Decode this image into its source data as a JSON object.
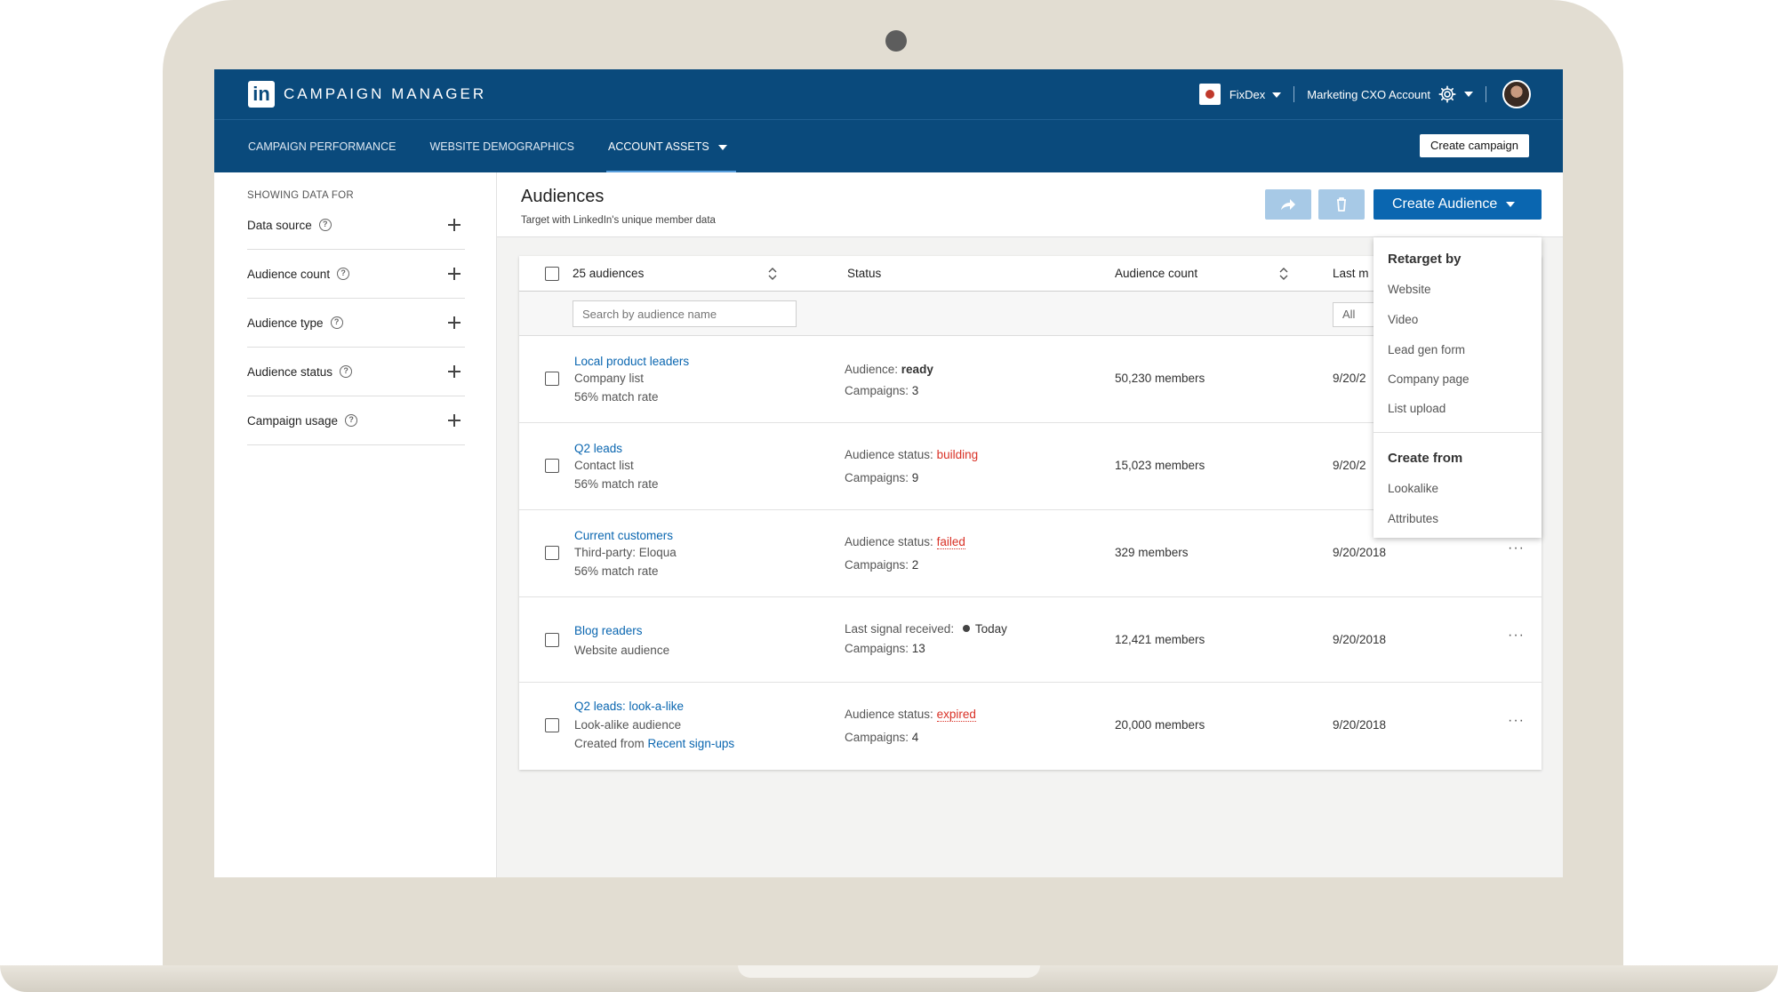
{
  "app": {
    "brand_logo": "in",
    "brand_name": "CAMPAIGN MANAGER",
    "account_name": "FixDex",
    "account_type": "Marketing CXO Account"
  },
  "nav": {
    "tabs": [
      {
        "label": "CAMPAIGN PERFORMANCE"
      },
      {
        "label": "WEBSITE DEMOGRAPHICS"
      },
      {
        "label": "ACCOUNT ASSETS"
      }
    ],
    "create_campaign_label": "Create campaign"
  },
  "sidebar": {
    "heading": "SHOWING DATA FOR",
    "help_glyph": "?",
    "filters": [
      {
        "label": "Data source"
      },
      {
        "label": "Audience count"
      },
      {
        "label": "Audience type"
      },
      {
        "label": "Audience status"
      },
      {
        "label": "Campaign usage"
      }
    ]
  },
  "main": {
    "title": "Audiences",
    "subtitle": "Target with LinkedIn's unique member data",
    "create_audience_label": "Create Audience"
  },
  "table": {
    "headers": {
      "name": "25 audiences",
      "status": "Status",
      "count": "Audience count",
      "modified": "Last m"
    },
    "search_placeholder": "Search by audience name",
    "date_filter_value": "All",
    "more_glyph": "···",
    "rows": [
      {
        "name": "Local product leaders",
        "line1": "Company list",
        "line2": "56% match rate",
        "status_label": "Audience: ",
        "status_value": "ready",
        "campaigns_label": "Campaigns: ",
        "campaigns_value": "3",
        "count": "50,230 members",
        "date": "9/20/2"
      },
      {
        "name": "Q2 leads",
        "line1": "Contact list",
        "line2": "56% match rate",
        "status_label": "Audience status: ",
        "status_value": "building",
        "campaigns_label": "Campaigns: ",
        "campaigns_value": "9",
        "count": "15,023 members",
        "date": "9/20/2"
      },
      {
        "name": "Current customers",
        "line1": "Third-party: Eloqua",
        "line2": "56% match rate",
        "status_label": "Audience status: ",
        "status_value": "failed",
        "campaigns_label": "Campaigns: ",
        "campaigns_value": "2",
        "count": "329 members",
        "date": "9/20/2018"
      },
      {
        "name": "Blog readers",
        "line1": "Website audience",
        "status_label": "Last signal received: ",
        "status_value": "Today",
        "campaigns_label": "Campaigns: ",
        "campaigns_value": "13",
        "count": "12,421 members",
        "date": "9/20/2018"
      },
      {
        "name": "Q2 leads: look-a-like",
        "line1": "Look-alike audience",
        "line2_prefix": "Created from ",
        "line2_link": "Recent sign-ups",
        "status_label": "Audience status: ",
        "status_value": "expired",
        "campaigns_label": "Campaigns: ",
        "campaigns_value": "4",
        "count": "20,000 members",
        "date": "9/20/2018"
      }
    ]
  },
  "dropdown": {
    "group1": "Retarget by",
    "group1_items": [
      "Website",
      "Video",
      "Lead gen form",
      "Company page",
      "List upload"
    ],
    "group2": "Create from",
    "group2_items": [
      "Lookalike",
      "Attributes"
    ]
  },
  "colors": {
    "header_blue": "#0a4a7c",
    "link_blue": "#0a66b0",
    "error_red": "#d93025",
    "disabled_blue": "#a7c9e6",
    "laptop_frame": "#e2ddd2"
  },
  "icons": [
    "linkedin-logo-icon",
    "gear-icon",
    "help-icon",
    "plus-icon",
    "share-icon",
    "trash-icon",
    "sort-icon",
    "chevron-down-icon",
    "more-icon"
  ]
}
